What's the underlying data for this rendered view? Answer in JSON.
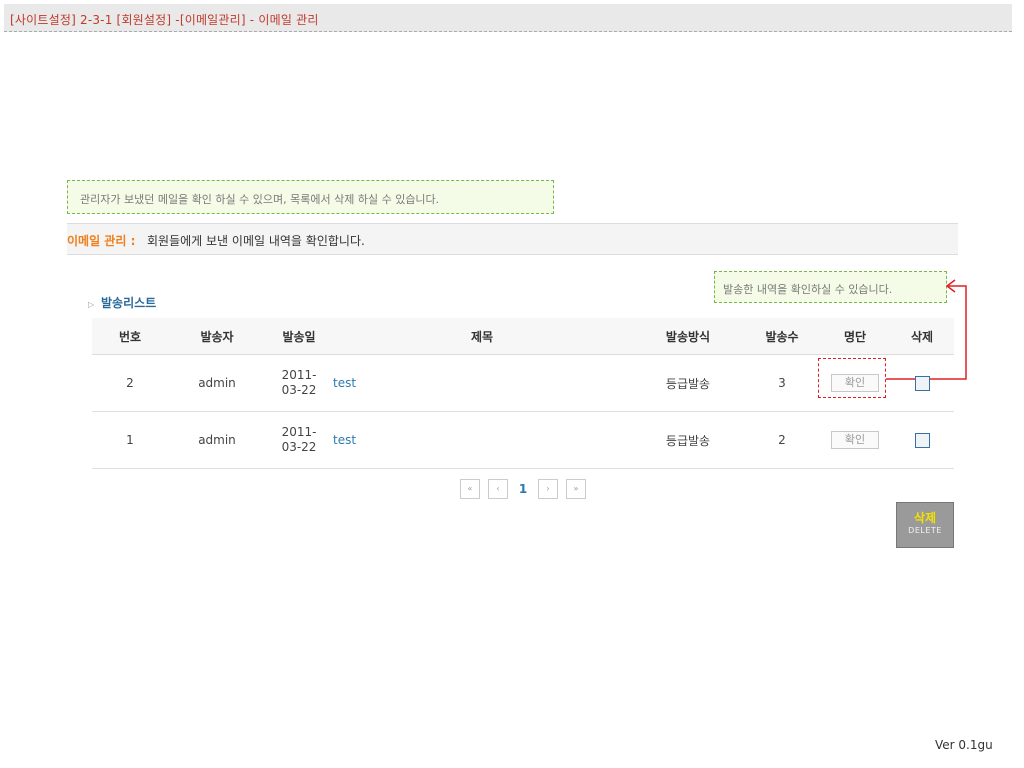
{
  "breadcrumb": "[사이트설정] 2-3-1 [회원설정] -[이메일관리] - 이메일 관리",
  "notes": {
    "top": "관리자가 보냈던 메일을 확인 하실 수 있으며, 목록에서 삭제 하실 수 있습니다.",
    "right": "발송한 내역을 확인하실 수 있습니다."
  },
  "section": {
    "title": "이메일 관리",
    "separator": ":",
    "desc": "회원들에게 보낸 이메일 내역을 확인합니다."
  },
  "list": {
    "title": "발송리스트",
    "icon": "bullet-icon",
    "columns": [
      "번호",
      "발송자",
      "발송일",
      "제목",
      "발송방식",
      "발송수",
      "명단",
      "삭제"
    ],
    "rows": [
      {
        "no": "2",
        "sender": "admin",
        "date_line1": "2011-",
        "date_line2": "03-22",
        "subject": "test",
        "method": "등급발송",
        "count": "3",
        "list_label": "확인"
      },
      {
        "no": "1",
        "sender": "admin",
        "date_line1": "2011-",
        "date_line2": "03-22",
        "subject": "test",
        "method": "등급발송",
        "count": "2",
        "list_label": "확인"
      }
    ]
  },
  "pagination": {
    "first": "«",
    "prev": "‹",
    "current": "1",
    "next": "›",
    "last": "»"
  },
  "delete_button": {
    "kr": "삭제",
    "en": "DELETE"
  },
  "version": "Ver 0.1gu",
  "colors": {
    "accent_red": "#e02020",
    "title_orange": "#f07e1a",
    "link_blue": "#2a7ab0"
  }
}
